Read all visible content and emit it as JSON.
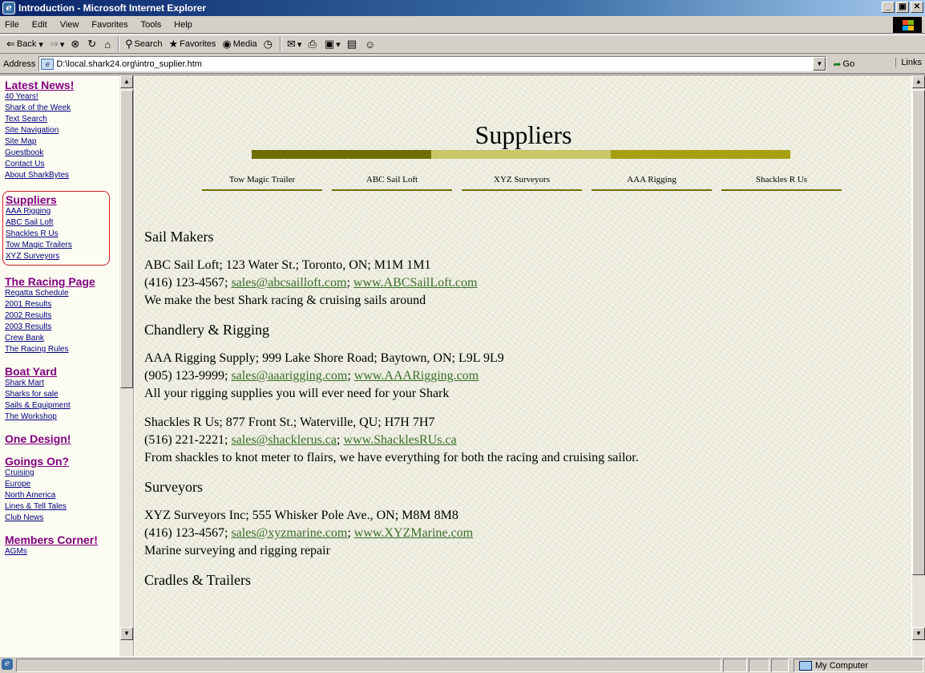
{
  "window": {
    "title": "Introduction - Microsoft Internet Explorer",
    "controls": [
      "_",
      "̅",
      "X"
    ]
  },
  "menu": [
    "File",
    "Edit",
    "View",
    "Favorites",
    "Tools",
    "Help"
  ],
  "toolbar": {
    "back": "Back",
    "search": "Search",
    "favorites": "Favorites",
    "media": "Media"
  },
  "address": {
    "label": "Address",
    "url": "D:\\local.shark24.org\\intro_suplier.htm",
    "go": "Go",
    "links": "Links"
  },
  "sidebar": {
    "groups": [
      {
        "heading": "Latest News!",
        "items": [
          "40 Years!",
          "Shark of the Week",
          "Text Search",
          "Site Navigation",
          "Site Map",
          "Guestbook",
          "Contact Us",
          "About SharkBytes"
        ]
      },
      {
        "heading": "Suppliers",
        "items": [
          "AAA Rigging",
          "ABC Sail Loft",
          "Shackles R Us",
          "Tow Magic Trailers",
          "XYZ Surveyors"
        ]
      },
      {
        "heading": "The Racing Page",
        "items": [
          "Regatta Schedule",
          "2001 Results",
          "2002 Results",
          "2003 Results",
          "Crew Bank",
          "The Racing Rules"
        ]
      },
      {
        "heading": "Boat Yard",
        "items": [
          "Shark Mart",
          "Sharks for sale",
          "Sails & Equipment",
          "The Workshop"
        ]
      },
      {
        "heading": "One Design!",
        "items": []
      },
      {
        "heading": "Goings On?",
        "items": [
          "Cruising",
          "Europe",
          "North America",
          "Lines & Tell Tales",
          "Club News"
        ]
      },
      {
        "heading": "Members Corner!",
        "items": [
          "AGMs"
        ]
      }
    ]
  },
  "page": {
    "title": "Suppliers",
    "subnav": [
      "Tow Magic Trailer",
      "ABC Sail Loft",
      "XYZ Surveyors",
      "AAA Rigging",
      "Shackles R Us"
    ],
    "sections": {
      "sail_makers": {
        "heading": "Sail Makers",
        "entries": [
          {
            "address": "ABC Sail Loft; 123 Water St.; Toronto, ON; M1M 1M1",
            "phone": "(416) 123-4567;",
            "email": "sales@abcsailloft.com",
            "web": "www.ABCSailLoft.com",
            "desc": "We make the best Shark racing & cruising sails around"
          }
        ]
      },
      "chandlery": {
        "heading": "Chandlery & Rigging",
        "entries": [
          {
            "address": "AAA Rigging Supply; 999 Lake Shore Road; Baytown, ON; L9L 9L9",
            "phone": "(905) 123-9999;",
            "email": "sales@aaarigging.com",
            "web": "www.AAARigging.com",
            "desc": "All your rigging supplies you will ever need for your Shark"
          },
          {
            "address": "Shackles R Us; 877 Front St.; Waterville, QU; H7H 7H7",
            "phone": "(516) 221-2221;",
            "email": "sales@shacklerus.ca",
            "web": "www.ShacklesRUs.ca",
            "desc": "From shackles to knot meter to flairs, we have everything for both the racing and cruising sailor."
          }
        ]
      },
      "surveyors": {
        "heading": "Surveyors",
        "entries": [
          {
            "address": "XYZ Surveyors Inc; 555 Whisker Pole Ave., ON; M8M 8M8",
            "phone": "(416) 123-4567;",
            "email": "sales@xyzmarine.com",
            "web": "www.XYZMarine.com",
            "desc": "Marine surveying and rigging repair"
          }
        ]
      },
      "cradles": {
        "heading": "Cradles & Trailers"
      }
    }
  },
  "status": {
    "zone": "My Computer"
  },
  "colors": {
    "titlebar": "#0a246a",
    "link_visited": "#800080",
    "link": "#000080",
    "content_link": "#3a6e2a",
    "highlight_border": "#d42020",
    "bar_dark": "#6e6e00",
    "bar_light": "#c8c868",
    "bar_mid": "#a8a010"
  }
}
